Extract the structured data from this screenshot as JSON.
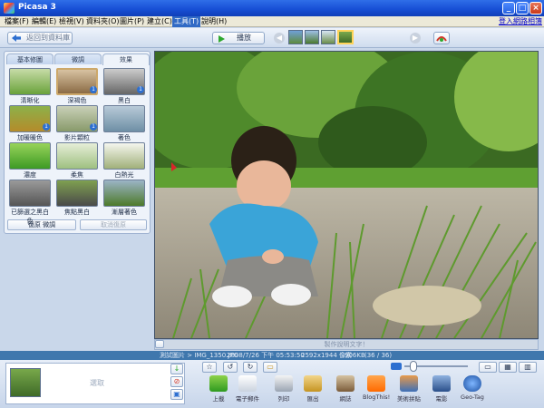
{
  "window": {
    "title": "Picasa 3"
  },
  "menu": {
    "items": [
      "檔案(F)",
      "編輯(E)",
      "檢視(V)",
      "資料夾(O)",
      "圖片(P)",
      "建立(C)",
      "工具(T)",
      "說明(H)"
    ],
    "active_index": 6,
    "login_link": "登入網路相簿"
  },
  "toolbar": {
    "back_label": "返回到資料庫",
    "play_label": "播放"
  },
  "panel": {
    "tabs": [
      "基本修圖",
      "微調",
      "效果"
    ],
    "selected_tab": 2,
    "effects": [
      {
        "label": "清晰化",
        "badge": ""
      },
      {
        "label": "深褐色",
        "badge": "1"
      },
      {
        "label": "黑白",
        "badge": "1"
      },
      {
        "label": "加暖暖色",
        "badge": "1"
      },
      {
        "label": "影片顆粒",
        "badge": "1"
      },
      {
        "label": "著色",
        "badge": ""
      },
      {
        "label": "濃度",
        "badge": ""
      },
      {
        "label": "柔焦",
        "badge": ""
      },
      {
        "label": "白熱光",
        "badge": ""
      },
      {
        "label": "已篩選之黑白色",
        "badge": ""
      },
      {
        "label": "焦點黑白",
        "badge": ""
      },
      {
        "label": "漸層著色",
        "badge": ""
      }
    ],
    "undo_label": "復原 微調",
    "redo_label": "取消復原"
  },
  "caption": {
    "placeholder": "製作說明文字！"
  },
  "info": {
    "path": "測試圖片 > IMG_1350.JPG",
    "datetime": "2008/7/26 下午 05:53:50",
    "dimensions": "2592x1944 像素",
    "filesize": "906KB",
    "position": "(36 / 36)"
  },
  "tray": {
    "label": "選取",
    "tools": [
      "上載",
      "電子郵件",
      "列印",
      "匯出",
      "網誌",
      "BlogThis!",
      "美術拼貼",
      "電影",
      "Geo-Tag"
    ]
  }
}
